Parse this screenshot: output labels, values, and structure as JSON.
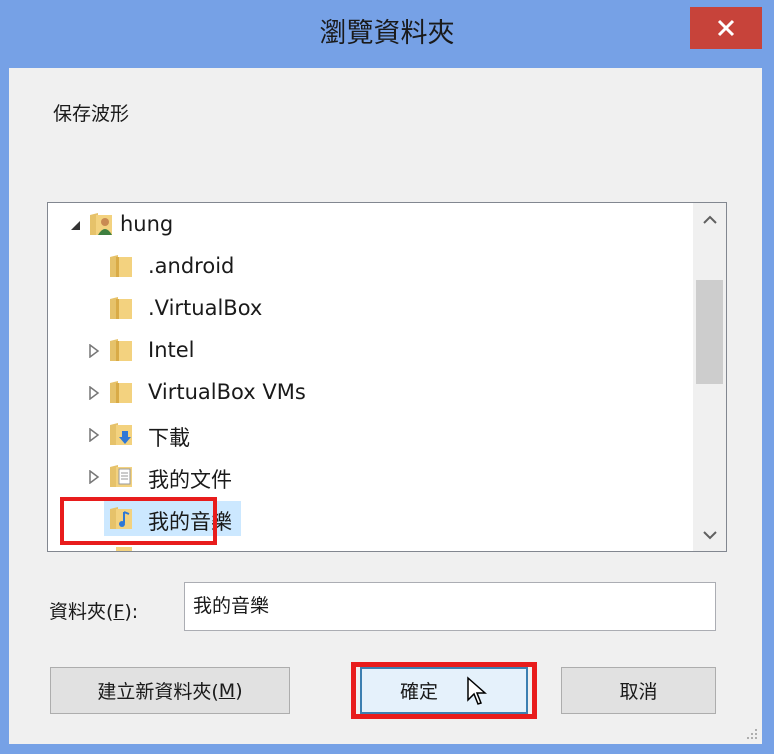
{
  "window": {
    "title": "瀏覽資料夾"
  },
  "description": "保存波形",
  "tree": {
    "items": [
      {
        "label": "hung",
        "icon": "user-folder-icon",
        "expander": "expanded",
        "indent": 0
      },
      {
        "label": ".android",
        "icon": "folder-icon",
        "expander": "none",
        "indent": 1
      },
      {
        "label": ".VirtualBox",
        "icon": "folder-icon",
        "expander": "none",
        "indent": 1
      },
      {
        "label": "Intel",
        "icon": "folder-icon",
        "expander": "collapsed",
        "indent": 1
      },
      {
        "label": "VirtualBox VMs",
        "icon": "folder-icon",
        "expander": "collapsed",
        "indent": 1
      },
      {
        "label": "下載",
        "icon": "downloads-folder-icon",
        "expander": "collapsed",
        "indent": 1
      },
      {
        "label": "我的文件",
        "icon": "documents-folder-icon",
        "expander": "collapsed",
        "indent": 1
      },
      {
        "label": "我的音樂",
        "icon": "music-folder-icon",
        "expander": "none",
        "indent": 1,
        "selected": true
      }
    ]
  },
  "folder_field": {
    "label": "資料夾(F):",
    "value": "我的音樂"
  },
  "buttons": {
    "new_folder": "建立新資料夾(M)",
    "ok": "確定",
    "cancel": "取消"
  },
  "colors": {
    "highlight": "#e81c1c",
    "title_bar": "#76a1e6",
    "close": "#c7433a"
  }
}
